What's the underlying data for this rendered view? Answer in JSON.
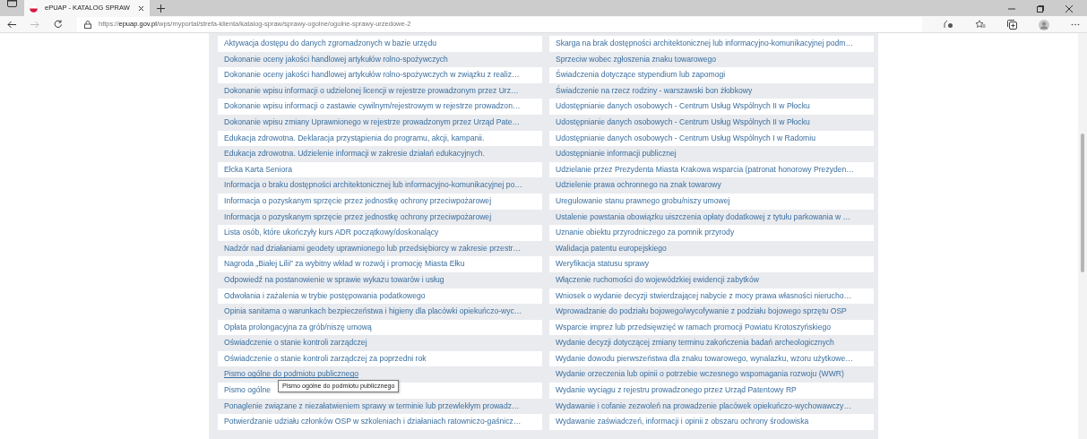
{
  "browser": {
    "tab_title": "ePUAP - KATALOG SPRAW",
    "url_scheme": "https://",
    "url_host": "epuap.gov.pl",
    "url_path": "/wps/myportal/strefa-klienta/katalog-spraw/sprawy-ogolne/ogolne-sprawy-urzedowe-2",
    "forward_disabled": true
  },
  "columns": [
    {
      "items": [
        {
          "text": "Aktywacja dostępu do danych zgromadzonych w bazie urzędu",
          "hovered": false
        },
        {
          "text": "Dokonanie oceny jakości handlowej artykułów rolno-spożywczych",
          "hovered": false
        },
        {
          "text": "Dokonanie oceny jakości handlowej artykułów rolno-spożywczych w związku z realiz…",
          "hovered": false
        },
        {
          "text": "Dokonanie wpisu informacji o udzielonej licencji w rejestrze prowadzonym przez Urz…",
          "hovered": false
        },
        {
          "text": "Dokonanie wpisu informacji o zastawie cywilnym/rejestrowym w rejestrze prowadzon…",
          "hovered": false
        },
        {
          "text": "Dokonanie wpisu zmiany Uprawnionego w rejestrze prowadzonym przez Urząd Pate…",
          "hovered": false
        },
        {
          "text": "Edukacja zdrowotna. Deklaracja przystąpienia do programu, akcji, kampanii.",
          "hovered": false
        },
        {
          "text": "Edukacja zdrowotna. Udzielenie informacji w zakresie działań edukacyjnych.",
          "hovered": false
        },
        {
          "text": "Ełcka Karta Seniora",
          "hovered": false
        },
        {
          "text": "Informacja o braku dostępności architektonicznej lub informacyjno-komunikacyjnej po…",
          "hovered": false
        },
        {
          "text": "Informacja o pozyskanym sprzęcie przez jednostkę ochrony przeciwpożarowej",
          "hovered": false
        },
        {
          "text": "Informacja o pozyskanym sprzęcie przez jednostkę ochrony przeciwpożarowej",
          "hovered": false
        },
        {
          "text": "Lista osób, które ukończyły kurs ADR początkowy/doskonalący",
          "hovered": false
        },
        {
          "text": "Nadzór nad działaniami geodety uprawnionego lub przedsiębiorcy w zakresie przestr…",
          "hovered": false
        },
        {
          "text": "Nagroda „Białej Lilii” za wybitny wkład w rozwój i promocję Miasta Ełku",
          "hovered": false
        },
        {
          "text": "Odpowiedź na postanowienie w sprawie wykazu towarów i usług",
          "hovered": false
        },
        {
          "text": "Odwołania i zażalenia w trybie postępowania podatkowego",
          "hovered": false
        },
        {
          "text": "Opinia sanitarna o warunkach bezpieczeństwa i higieny dla placówki opiekuńczo-wyc…",
          "hovered": false
        },
        {
          "text": "Opłata prolongacyjna za grób/niszę umową",
          "hovered": false
        },
        {
          "text": "Oświadczenie o stanie kontroli zarządczej",
          "hovered": false
        },
        {
          "text": "Oświadczenie o stanie kontroli zarządczej za poprzedni rok",
          "hovered": false
        },
        {
          "text": "Pismo ogólne do podmiotu publicznego",
          "hovered": true
        },
        {
          "text": "Pismo ogólne",
          "hovered": false
        },
        {
          "text": "Ponaglenie związane z niezałatwieniem sprawy w terminie lub przewlekłym prowadz…",
          "hovered": false
        },
        {
          "text": "Potwierdzanie udziału członków OSP w szkoleniach i działaniach ratowniczo-gaśnicz…",
          "hovered": false
        }
      ]
    },
    {
      "items": [
        {
          "text": "Skarga na brak dostępności architektonicznej lub informacyjno-komunikacyjnej podm…",
          "hovered": false
        },
        {
          "text": "Sprzeciw wobec zgłoszenia znaku towarowego",
          "hovered": false
        },
        {
          "text": "Świadczenia dotyczące stypendium lub zapomogi",
          "hovered": false
        },
        {
          "text": "Świadczenie na rzecz rodziny - warszawski bon żłobkowy",
          "hovered": false
        },
        {
          "text": "Udostępnianie danych osobowych - Centrum Usług Wspólnych II w Płocku",
          "hovered": false
        },
        {
          "text": "Udostępnianie danych osobowych - Centrum Usług Wspólnych II w Płocku",
          "hovered": false
        },
        {
          "text": "Udostępnianie danych osobowych - Centrum Usług Wspólnych I w Radomiu",
          "hovered": false
        },
        {
          "text": "Udostępnianie informacji publicznej",
          "hovered": false
        },
        {
          "text": "Udzielanie przez Prezydenta Miasta Krakowa wsparcia (patronat honorowy Prezyden…",
          "hovered": false
        },
        {
          "text": "Udzielenie prawa ochronnego na znak towarowy",
          "hovered": false
        },
        {
          "text": "Uregulowanie stanu prawnego grobu/niszy umowej",
          "hovered": false
        },
        {
          "text": "Ustalenie powstania obowiązku uiszczenia opłaty dodatkowej z tytułu parkowania w …",
          "hovered": false
        },
        {
          "text": "Uznanie obiektu przyrodniczego za pomnik przyrody",
          "hovered": false
        },
        {
          "text": "Walidacja patentu europejskiego",
          "hovered": false
        },
        {
          "text": "Weryfikacja statusu sprawy",
          "hovered": false
        },
        {
          "text": "Włączenie ruchomości do wojewódzkiej ewidencji zabytków",
          "hovered": false
        },
        {
          "text": "Wniosek o wydanie decyzji stwierdzającej nabycie z mocy prawa własności nierucho…",
          "hovered": false
        },
        {
          "text": "Wprowadzanie do podziału bojowego/wycofywanie z podziału bojowego sprzętu OSP",
          "hovered": false
        },
        {
          "text": "Wsparcie imprez lub przedsięwzięć w ramach promocji Powiatu Krotoszyńskiego",
          "hovered": false
        },
        {
          "text": "Wydanie decyzji dotyczącej zmiany terminu zakończenia badań archeologicznych",
          "hovered": false
        },
        {
          "text": "Wydanie dowodu pierwszeństwa dla znaku towarowego, wynalazku, wzoru użytkowe…",
          "hovered": false
        },
        {
          "text": "Wydanie orzeczenia lub opinii o potrzebie wczesnego wspomagania rozwoju (WWR)",
          "hovered": false
        },
        {
          "text": "Wydanie wyciągu z rejestru prowadzonego przez Urząd Patentowy RP",
          "hovered": false
        },
        {
          "text": "Wydawanie i cofanie zezwoleń na prowadzenie placówek opiekuńczo-wychowawczy…",
          "hovered": false
        },
        {
          "text": "Wydawanie zaświadczeń, informacji i opinii z obszaru ochrony środowiska",
          "hovered": false
        }
      ]
    }
  ],
  "tooltip": {
    "text": "Pismo ogólne do podmiotu publicznego"
  }
}
